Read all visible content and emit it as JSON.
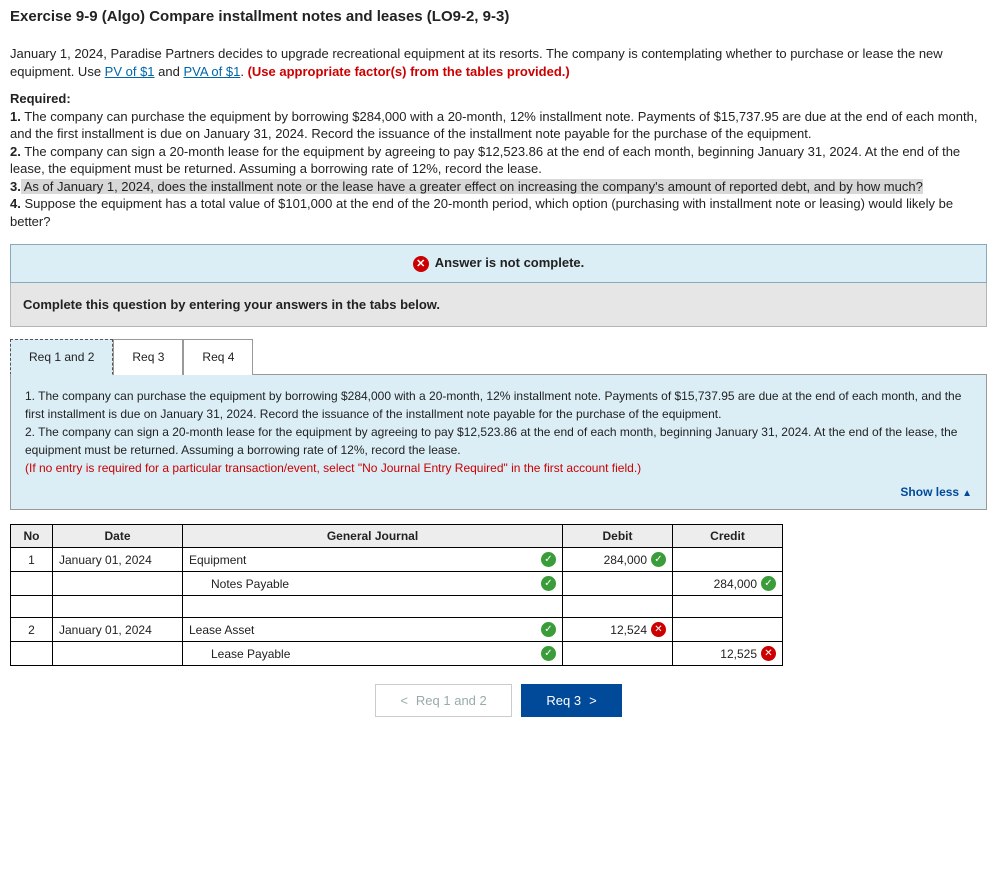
{
  "title": "Exercise 9-9 (Algo) Compare installment notes and leases (LO9-2, 9-3)",
  "intro": {
    "pre": "January 1, 2024, Paradise Partners decides to upgrade recreational equipment at its resorts. The company is contemplating whether to purchase or lease the new equipment. Use ",
    "link1": "PV of $1",
    "mid": " and ",
    "link2": "PVA of $1",
    "post": ". ",
    "red": "(Use appropriate factor(s) from the tables provided.)"
  },
  "required_label": "Required:",
  "reqs": {
    "r1b": "1.",
    "r1": " The company can purchase the equipment by borrowing $284,000 with a 20-month, 12% installment note. Payments of $15,737.95 are due at the end of each month, and the first installment is due on January 31, 2024. Record the issuance of the installment note payable for the purchase of the equipment.",
    "r2b": "2.",
    "r2": " The company can sign a 20-month lease for the equipment by agreeing to pay $12,523.86 at the end of each month, beginning January 31, 2024. At the end of the lease, the equipment must be returned. Assuming a borrowing rate of 12%, record the lease.",
    "r3b": "3.",
    "r3hl": " As of January 1, 2024, does the installment note or the lease have a greater effect on increasing the company's amount of reported debt, and by how much?",
    "r4b": "4.",
    "r4": " Suppose the equipment has a total value of $101,000 at the end of the 20-month period, which option (purchasing with installment note or leasing) would likely be better?"
  },
  "status": "Answer is not complete.",
  "instruct": "Complete this question by entering your answers in the tabs below.",
  "tabs": {
    "t1": "Req 1 and 2",
    "t2": "Req 3",
    "t3": "Req 4"
  },
  "panel": {
    "p1": "1. The company can purchase the equipment by borrowing $284,000 with a 20-month, 12% installment note. Payments of $15,737.95 are due at the end of each month, and the first installment is due on January 31, 2024. Record the issuance of the installment note payable for the purchase of the equipment.",
    "p2": "2. The company can sign a 20-month lease for the equipment by agreeing to pay $12,523.86 at the end of each month, beginning January 31, 2024. At the end of the lease, the equipment must be returned. Assuming a borrowing rate of 12%, record the lease.",
    "note": "(If no entry is required for a particular transaction/event, select \"No Journal Entry Required\" in the first account field.)",
    "showless": "Show less"
  },
  "table": {
    "headers": {
      "no": "No",
      "date": "Date",
      "gj": "General Journal",
      "debit": "Debit",
      "credit": "Credit"
    },
    "rows": [
      {
        "no": "1",
        "date": "January 01, 2024",
        "account": "Equipment",
        "acct_mark": "ok",
        "debit": "284,000",
        "debit_mark": "ok",
        "credit": "",
        "credit_mark": ""
      },
      {
        "no": "",
        "date": "",
        "account": "Notes Payable",
        "indent": true,
        "acct_mark": "ok",
        "debit": "",
        "debit_mark": "",
        "credit": "284,000",
        "credit_mark": "ok"
      },
      {
        "spacer": true
      },
      {
        "no": "2",
        "date": "January 01, 2024",
        "account": "Lease Asset",
        "acct_mark": "ok",
        "debit": "12,524",
        "debit_mark": "bad",
        "credit": "",
        "credit_mark": ""
      },
      {
        "no": "",
        "date": "",
        "account": "Lease Payable",
        "indent": true,
        "acct_mark": "ok",
        "debit": "",
        "debit_mark": "",
        "credit": "12,525",
        "credit_mark": "bad"
      }
    ]
  },
  "nav": {
    "prev": "Req 1 and 2",
    "next": "Req 3"
  }
}
